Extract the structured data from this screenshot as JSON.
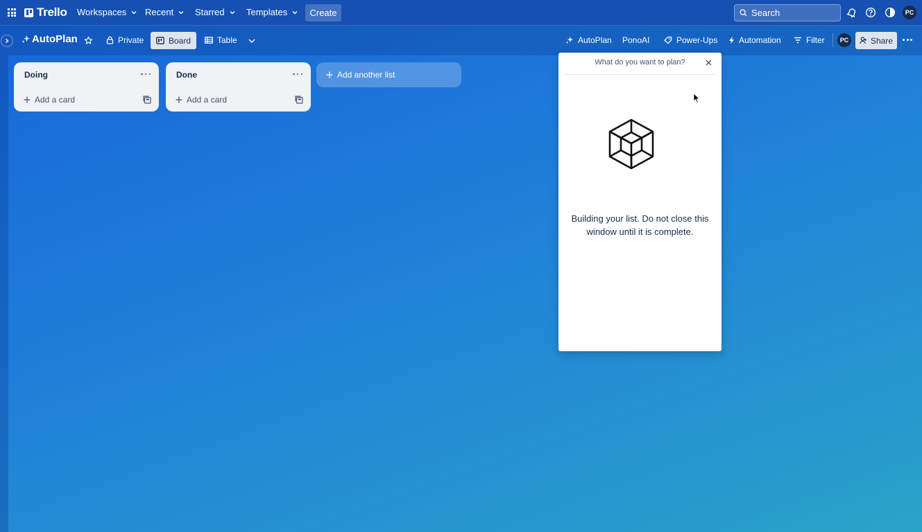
{
  "topnav": {
    "logo": "Trello",
    "items": [
      {
        "label": "Workspaces"
      },
      {
        "label": "Recent"
      },
      {
        "label": "Starred"
      },
      {
        "label": "Templates"
      }
    ],
    "create_label": "Create",
    "search_placeholder": "Search",
    "avatar_initials": "PC"
  },
  "board": {
    "title": "AutoPlan",
    "visibility": "Private",
    "views": {
      "board": "Board",
      "table": "Table"
    },
    "powerups": {
      "autoplan": "AutoPlan",
      "ponoai": "PonoAI",
      "powerups": "Power-Ups",
      "automation": "Automation",
      "filter": "Filter"
    },
    "member_initials": "PC",
    "share_label": "Share"
  },
  "lists": [
    {
      "title": "Doing",
      "add_card": "Add a card"
    },
    {
      "title": "Done",
      "add_card": "Add a card"
    }
  ],
  "add_list_label": "Add another list",
  "popup": {
    "title": "What do you want to plan?",
    "message": "Building your list. Do not close this window until it is complete."
  },
  "colors": {
    "nav": "#1650b3",
    "list_bg": "#f1f2f4",
    "text": "#172b4d"
  }
}
